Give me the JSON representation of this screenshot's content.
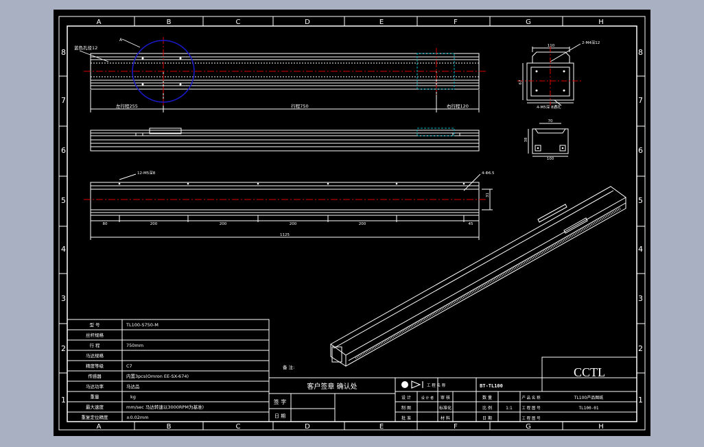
{
  "grid": {
    "columns": [
      "A",
      "B",
      "C",
      "D",
      "E",
      "F",
      "G",
      "H"
    ],
    "rows": [
      "8",
      "7",
      "6",
      "5",
      "4",
      "3",
      "2",
      "1"
    ]
  },
  "top_view": {
    "hole_note": "蓝色孔径12",
    "marker_a": "A",
    "dim_left": "左行程255",
    "dim_stroke": "行程750",
    "dim_right": "右行程120"
  },
  "bottom_view": {
    "note_left": "12-M5深8",
    "note_right": "4-Φ6.5",
    "dim_height": "31",
    "dim_seg_first": "80",
    "dim_seg": [
      "200",
      "200",
      "200",
      "200"
    ],
    "dim_seg_last": "45",
    "dim_total": "1125"
  },
  "end_view_top": {
    "dim_width": "110",
    "dim_height": "67",
    "note_right": "2-M4深12",
    "note_bottom": "4-M5深 8通孔"
  },
  "end_view_bottom": {
    "dim_top": "70",
    "dim_side": "38",
    "dim_bottom": "100"
  },
  "spec_table": {
    "rows": [
      {
        "label": "型 号",
        "value": "TL100-S750-M"
      },
      {
        "label": "丝杆规格",
        "value": ""
      },
      {
        "label": "行 程",
        "value": "750mm"
      },
      {
        "label": "马达规格",
        "value": ""
      },
      {
        "label": "精度等级",
        "value": "C7"
      },
      {
        "label": "传感器",
        "value": "内置3pcs(Omron EE-SX-674)"
      },
      {
        "label": "马达功率",
        "value": "马达品"
      },
      {
        "label": "重量",
        "value": "kg"
      },
      {
        "label": "最大速度",
        "value": "mm/sec 马达转速以3000RPM为基准)"
      },
      {
        "label": "重复定位精度",
        "value": "±0.02mm"
      }
    ]
  },
  "remarks_label": "备 注:",
  "confirm": {
    "title": "客户签章 确认处",
    "sign_label": "签 字",
    "date_label": "日 期"
  },
  "title_block": {
    "company_name_label": "工 程 名 称",
    "drawing_no": "BT-TL100",
    "designer_label": "设 计",
    "designer_name": "设 计 者",
    "check_label": "审 核",
    "draft_label": "制 图",
    "std_label": "标准化",
    "approve_label": "批 准",
    "date_label": "日 期",
    "qty_label": "数 量",
    "scale_label": "比 例",
    "scale_value": "1:1",
    "material_label": "材 料",
    "product_name_label": "产 品 名 称",
    "product_name": "TL100产品图纸",
    "drawing_code_label": "工 程 图 号",
    "drawing_code": "TL100-01",
    "page_label": "工 程 图 号"
  },
  "brand": "CCTL",
  "colors": {
    "frame": "#ffffff",
    "center_line": "#e00000",
    "circle": "#1a1acc",
    "detail_box": "#00b8c8"
  }
}
